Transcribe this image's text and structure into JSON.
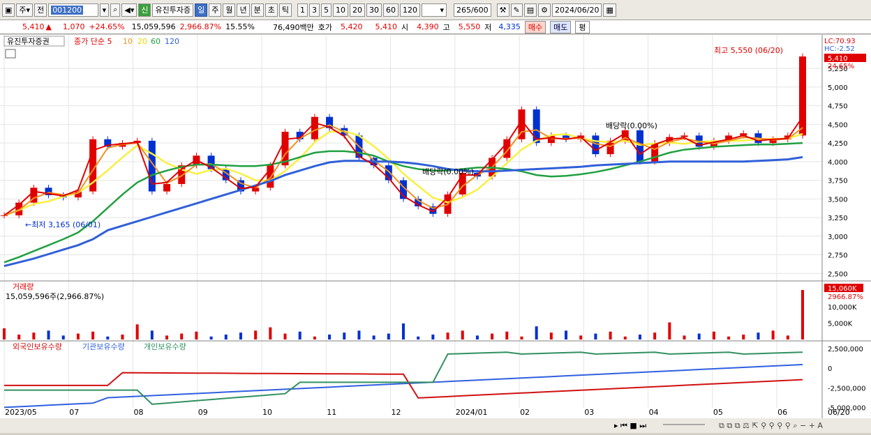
{
  "toolbar": {
    "market": "주",
    "mode": "전",
    "code": "001200",
    "indicator": "신",
    "name": "유진투자증",
    "periods": [
      "일",
      "주",
      "월",
      "년",
      "분",
      "초",
      "틱"
    ],
    "active_period": "일",
    "intervals": [
      "1",
      "3",
      "5",
      "10",
      "20",
      "30",
      "60",
      "120"
    ],
    "count": "265",
    "count_max": "/600",
    "date": "2024/06/20"
  },
  "quote": {
    "price": "5,410",
    "arrow": "▲",
    "change": "1,070",
    "change_pct": "+24.65%",
    "volume": "15,059,596",
    "volume_pct": "2,966.87%",
    "turnover": "15.55%",
    "amount": "76,490백만",
    "label_hoga": "호가",
    "hoga_ask": "5,420",
    "hoga_bid": "5,410",
    "label_open": "시",
    "open": "4,390",
    "label_high": "고",
    "high": "5,550",
    "label_low": "저",
    "low": "4,335",
    "buy": "매수",
    "sell": "매도",
    "eval": "평"
  },
  "legend": {
    "name": "유진투자증권",
    "close": "종가",
    "simple": "단순",
    "ma": [
      "5",
      "10",
      "20",
      "60",
      "120"
    ]
  },
  "colors": {
    "up": "#e00000",
    "down": "#0030d0",
    "ma5": "#e00000",
    "ma10": "#f09020",
    "ma20": "#f8f040",
    "ma60": "#20a040",
    "ma120": "#3060d8",
    "foreign": "#d01010",
    "inst": "#3060e0",
    "indiv": "#309060"
  },
  "labels": {
    "lc": "LC:70.93",
    "hc": "HC:-2.52",
    "price_tag": "5,410",
    "pct_tag": "24.65%",
    "high_note": "최고 5,550 (06/20)",
    "low_note": "←최저 3,165 (06/01)",
    "div1": "배당락(0.00%)",
    "div2": "배당락(0.00%)",
    "vol_title": "거래량",
    "vol_info": "15,059,596주(2,966.87%)",
    "vol_tag": "15,060K",
    "vol_pct_tag": "2966.87%",
    "f_title": "외국인보유수량",
    "i_title": "기관보유수량",
    "p_title": "개인보유수량",
    "last_date": "06/20"
  },
  "chart_data": [
    {
      "type": "candlestick",
      "title": "유진투자증권",
      "ylim": [
        2400,
        5700
      ],
      "yticks": [
        "5,250",
        "5,000",
        "4,750",
        "4,500",
        "4,250",
        "4,000",
        "3,750",
        "3,500",
        "3,250",
        "3,000",
        "2,750",
        "2,500"
      ],
      "yvals": [
        5250,
        5000,
        4750,
        4500,
        4250,
        4000,
        3750,
        3500,
        3250,
        3000,
        2750,
        2500
      ],
      "x": [
        "2023/05",
        "07",
        "08",
        "09",
        "10",
        "11",
        "12",
        "2024/01",
        "02",
        "03",
        "04",
        "05",
        "06"
      ],
      "close": [
        3280,
        3450,
        3650,
        3550,
        3520,
        3600,
        4300,
        4200,
        4250,
        4280,
        3600,
        3700,
        3950,
        4080,
        3900,
        3750,
        3600,
        3650,
        3950,
        4400,
        4300,
        4600,
        4450,
        4350,
        4050,
        3950,
        3750,
        3500,
        3400,
        3300,
        3560,
        3850,
        3800,
        4050,
        4300,
        4700,
        4250,
        4350,
        4300,
        4350,
        4100,
        4280,
        4420,
        4000,
        4250,
        4330,
        4350,
        4200,
        4280,
        4350,
        4380,
        4250,
        4300,
        4350,
        5410
      ],
      "ma5": [
        3280,
        3420,
        3600,
        3570,
        3540,
        3620,
        4150,
        4220,
        4240,
        4260,
        3700,
        3720,
        3900,
        4020,
        3920,
        3780,
        3640,
        3660,
        3900,
        4300,
        4320,
        4520,
        4460,
        4340,
        4070,
        3960,
        3780,
        3540,
        3420,
        3330,
        3520,
        3820,
        3820,
        4030,
        4250,
        4550,
        4300,
        4320,
        4300,
        4330,
        4150,
        4260,
        4380,
        4100,
        4230,
        4300,
        4320,
        4220,
        4260,
        4300,
        4350,
        4280,
        4300,
        4310,
        4600
      ],
      "ma60": [
        2650,
        2720,
        2800,
        2880,
        2960,
        3050,
        3200,
        3380,
        3560,
        3720,
        3820,
        3880,
        3930,
        3960,
        3960,
        3950,
        3940,
        3940,
        3960,
        4000,
        4060,
        4120,
        4140,
        4140,
        4120,
        4080,
        4000,
        3940,
        3900,
        3880,
        3880,
        3900,
        3920,
        3920,
        3900,
        3870,
        3820,
        3800,
        3810,
        3830,
        3860,
        3900,
        3950,
        4000,
        4060,
        4120,
        4160,
        4180,
        4200,
        4210,
        4220,
        4230,
        4230,
        4240,
        4250
      ],
      "ma120": [
        2600,
        2650,
        2700,
        2760,
        2820,
        2880,
        2960,
        3080,
        3140,
        3200,
        3260,
        3320,
        3380,
        3440,
        3500,
        3560,
        3620,
        3680,
        3740,
        3820,
        3880,
        3940,
        3990,
        4010,
        4010,
        4000,
        4000,
        3990,
        3970,
        3940,
        3900,
        3880,
        3870,
        3870,
        3880,
        3890,
        3900,
        3910,
        3920,
        3930,
        3950,
        3960,
        3970,
        3980,
        3990,
        4000,
        4000,
        4000,
        4000,
        4000,
        4000,
        4010,
        4020,
        4030,
        4060
      ],
      "high": "5,550",
      "low": "3,165"
    },
    {
      "type": "bar",
      "title": "거래량",
      "yticks": [
        "10,000K",
        "5,000K"
      ],
      "yvals": [
        10000,
        5000
      ],
      "last": 15060
    },
    {
      "type": "line",
      "title": "보유수량",
      "yticks": [
        "2,500,000",
        "0",
        "-2,500,000",
        "-5,000,000"
      ],
      "yvals": [
        2500000,
        0,
        -2500000,
        -5000000
      ]
    }
  ]
}
